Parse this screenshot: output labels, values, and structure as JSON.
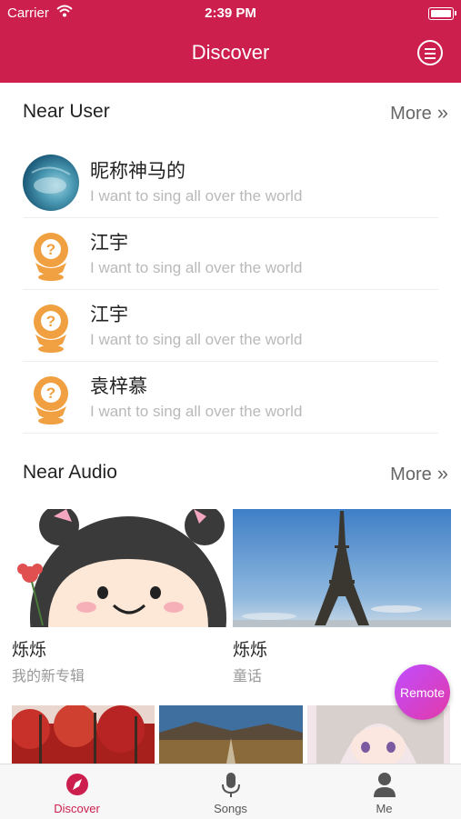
{
  "status_bar": {
    "carrier": "Carrier",
    "time": "2:39 PM"
  },
  "nav": {
    "title": "Discover",
    "menu_icon": "menu-circle-icon"
  },
  "near_user": {
    "title": "Near User",
    "more_label": "More",
    "users": [
      {
        "name": "昵称神马的",
        "subtitle": "I want to sing all over the world",
        "avatar": "photo"
      },
      {
        "name": "江宇",
        "subtitle": "I want to sing all over the world",
        "avatar": "default"
      },
      {
        "name": "江宇",
        "subtitle": "I want to sing all over the world",
        "avatar": "default"
      },
      {
        "name": "袁梓慕",
        "subtitle": "I want to sing all over the world",
        "avatar": "default"
      }
    ]
  },
  "near_audio": {
    "title": "Near Audio",
    "more_label": "More",
    "items": [
      {
        "title": "烁烁",
        "subtitle": "我的新专辑"
      },
      {
        "title": "烁烁",
        "subtitle": "童话"
      }
    ]
  },
  "remote_button": {
    "label": "Remote"
  },
  "tabs": [
    {
      "label": "Discover",
      "icon": "compass-icon",
      "active": true
    },
    {
      "label": "Songs",
      "icon": "microphone-icon",
      "active": false
    },
    {
      "label": "Me",
      "icon": "person-icon",
      "active": false
    }
  ],
  "colors": {
    "brand": "#cc1f4e",
    "avatar_orange": "#f0a040",
    "remote_gradient": "#c04cff"
  }
}
